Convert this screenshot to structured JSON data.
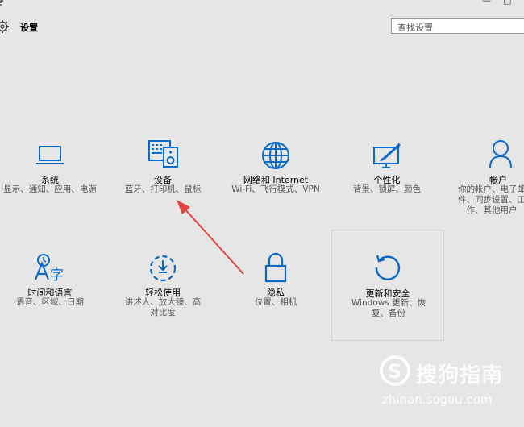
{
  "window": {
    "title": "置",
    "minimize": "—",
    "maximize": "□"
  },
  "header": {
    "title": "设置"
  },
  "search": {
    "placeholder": "查找设置"
  },
  "tiles": [
    {
      "label": "系统",
      "desc": "显示、通知、应用、电源",
      "icon": "laptop-icon"
    },
    {
      "label": "设备",
      "desc": "蓝牙、打印机、鼠标",
      "icon": "devices-icon"
    },
    {
      "label": "网络和 Internet",
      "desc": "Wi-Fi、飞行模式、VPN",
      "icon": "globe-icon"
    },
    {
      "label": "个性化",
      "desc": "背景、锁屏、颜色",
      "icon": "personalization-icon"
    },
    {
      "label": "帐户",
      "desc": "你的帐户、电子邮件、同步设置、工作、其他用户",
      "icon": "person-icon"
    },
    {
      "label": "时间和语言",
      "desc": "语音、区域、日期",
      "icon": "time-language-icon"
    },
    {
      "label": "轻松使用",
      "desc": "讲述人、放大镜、高对比度",
      "icon": "ease-of-access-icon"
    },
    {
      "label": "隐私",
      "desc": "位置、相机",
      "icon": "lock-icon"
    },
    {
      "label": "更新和安全",
      "desc": "Windows 更新、恢复、备份",
      "icon": "update-icon"
    }
  ],
  "watermark": {
    "title": "搜狗指南",
    "url": "zhinan.sogou.com"
  },
  "colors": {
    "accent": "#0a6ac9",
    "arrow": "#e8423d",
    "background": "#e6e6e6"
  }
}
